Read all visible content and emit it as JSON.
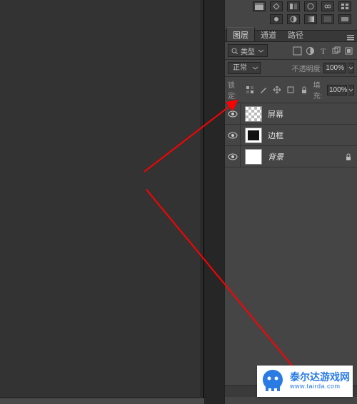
{
  "tabs": {
    "layers": "图层",
    "channels": "通道",
    "paths": "路径"
  },
  "filter": {
    "type_label": "类型"
  },
  "blend": {
    "mode": "正常",
    "opacity_label": "不透明度:",
    "opacity_value": "100%"
  },
  "lock": {
    "label": "锁定:",
    "fill_label": "填充:",
    "fill_value": "100%"
  },
  "layers": [
    {
      "name": "屏幕"
    },
    {
      "name": "边框"
    },
    {
      "name": "背景"
    }
  ],
  "tool_icons_row1": [
    "swatches-icon",
    "scale-icon",
    "flip-icon",
    "reset-icon",
    "link-icon",
    "grid-icon"
  ],
  "tool_icons_row2": [
    "mask-icon",
    "adjust-icon",
    "gradient-icon",
    "pattern-icon",
    "solid-icon"
  ],
  "filter_icons": [
    "image-filter-icon",
    "adjust-filter-icon",
    "text-filter-icon",
    "shape-filter-icon",
    "smart-filter-icon"
  ],
  "lock_icons": [
    "lock-transparent-icon",
    "lock-paint-icon",
    "lock-move-icon",
    "lock-artboard-icon",
    "lock-all-icon"
  ],
  "watermark": {
    "zh": "泰尔达游戏网",
    "en": "www.tairda.com",
    "color": "#2a7be4"
  }
}
